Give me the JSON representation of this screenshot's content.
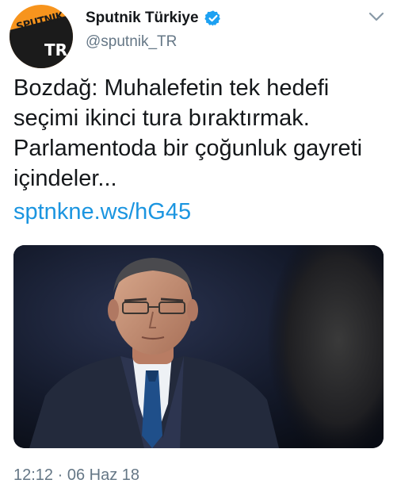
{
  "tweet": {
    "avatar_brand": "SPUTNIK",
    "avatar_region": "TR",
    "display_name": "Sputnik Türkiye",
    "handle": "@sputnik_TR",
    "verified": true,
    "text_lines": [
      "Bozdağ: Muhalefetin tek hedefi",
      "seçimi ikinci tura bıraktırmak.",
      "Parlamentoda bir çoğunluk gayreti",
      "içindeler..."
    ],
    "link": "sptnkne.ws/hG45",
    "time": "12:12",
    "separator": "·",
    "date": "06 Haz 18"
  },
  "icons": {
    "verified": "verified-badge-icon",
    "menu": "chevron-down-icon"
  },
  "colors": {
    "brand_orange": "#f7941d",
    "verified_blue": "#1da1f2",
    "link_blue": "#1b95e0",
    "secondary_text": "#657786"
  }
}
